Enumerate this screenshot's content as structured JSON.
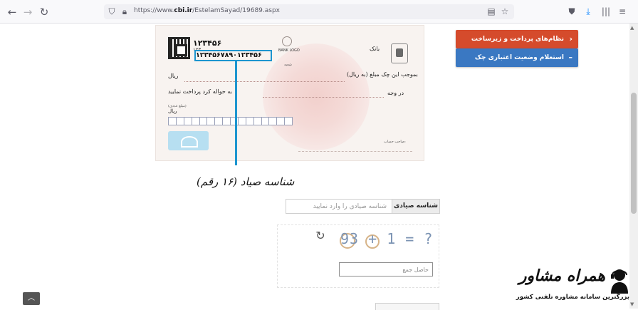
{
  "browser": {
    "url_prefix": "https://www.",
    "url_domain": "cbi.ir",
    "url_path": "/EstelamSayad/19689.aspx",
    "icons": [
      "back-icon",
      "forward-icon",
      "reload-icon",
      "shield-icon",
      "lock-icon",
      "reader-icon",
      "bookmark-star-icon",
      "pocket-icon",
      "download-icon",
      "library-icon",
      "menu-icon"
    ]
  },
  "cheque": {
    "serial": "۱۲۳۴۵۶",
    "small_code": "۱۲۳",
    "sayad_number": "۱۲۳۴۵۶۷۸۹۰۱۲۳۴۵۶",
    "bank_logo": "BANK LOGO",
    "bank_name": "بانک",
    "branch": "شعبه",
    "pay_to": "بموجب این چک مبلغ (به ریال)",
    "rial_1": "ریال",
    "rial_2": "ریال",
    "to_order": "به حواله کرد پرداخت نمایید",
    "digits_label": "(مبلغ عددی)",
    "dar_vajh": "در وجه",
    "account_holder": "صاحب حساب:"
  },
  "annotation": {
    "caption": "شناسه صیاد (۱۶ رقم)",
    "accent": "#1d95cf"
  },
  "menu": {
    "payment_label": "نظام‌های پرداخت و زیرساخت",
    "payment_arrow": "‹",
    "inquiry_label": "استعلام وضعیت اعتباری چک صیادی",
    "inquiry_arrow": "–",
    "payment_color": "#d54b2c",
    "inquiry_color": "#3a78c2"
  },
  "form": {
    "sayad_label": "شناسه صیادی",
    "sayad_placeholder": "شناسه صیادی را وارد نمایید",
    "captcha_text": "93 + 1 = ?",
    "captcha_placeholder": "حاصل جمع"
  },
  "watermark": {
    "title": "همراه مشاور",
    "subtitle": "بزرگترین سامانه مشاوره تلفنی کشور"
  }
}
